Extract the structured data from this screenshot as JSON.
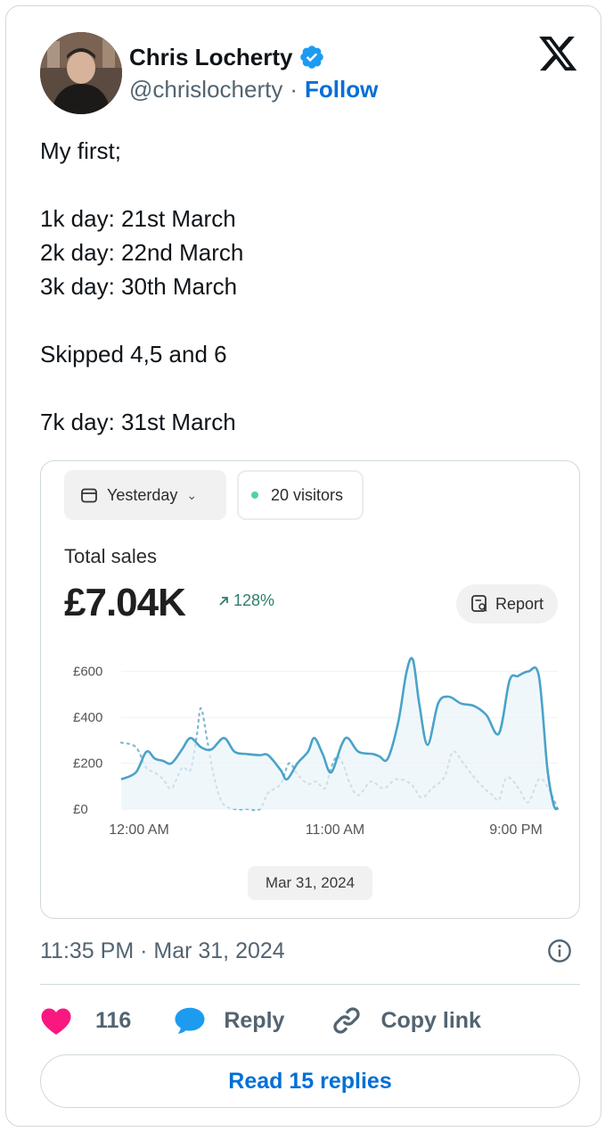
{
  "author": {
    "name": "Chris Locherty",
    "handle": "@chrislocherty",
    "separator": "·",
    "follow_label": "Follow",
    "verified": true,
    "verified_color": "#1d9bf0"
  },
  "tweet": {
    "lines": [
      "My first;",
      "",
      "1k day: 21st March",
      "2k day: 22nd March",
      "3k day: 30th March",
      "",
      "Skipped 4,5 and 6",
      "",
      "7k day: 31st March"
    ]
  },
  "media": {
    "date_filter": "Yesterday",
    "visitors_label": "20 visitors",
    "total_label": "Total sales",
    "total_value": "£7.04K",
    "change_label": "128%",
    "report_label": "Report",
    "date_chip": "Mar 31, 2024"
  },
  "chart_data": {
    "type": "line",
    "ylim": [
      0,
      700
    ],
    "yticks": [
      "£600",
      "£400",
      "£200",
      "£0"
    ],
    "ytick_values": [
      600,
      400,
      200,
      0
    ],
    "xticks": [
      "12:00 AM",
      "11:00 AM",
      "9:00 PM"
    ],
    "xtick_hours": [
      0,
      11,
      21
    ],
    "x_hours_max": 24,
    "series": [
      {
        "style": "solid",
        "color": "#4aa3c9",
        "points": [
          [
            0,
            130
          ],
          [
            0.7,
            160
          ],
          [
            1.2,
            250
          ],
          [
            1.6,
            220
          ],
          [
            2,
            210
          ],
          [
            2.4,
            200
          ],
          [
            2.9,
            260
          ],
          [
            3.3,
            310
          ],
          [
            3.8,
            270
          ],
          [
            4.3,
            260
          ],
          [
            4.9,
            310
          ],
          [
            5.4,
            250
          ],
          [
            6,
            240
          ],
          [
            6.6,
            235
          ],
          [
            7,
            235
          ],
          [
            7.6,
            170
          ],
          [
            7.9,
            130
          ],
          [
            8.4,
            200
          ],
          [
            8.9,
            250
          ],
          [
            9.2,
            310
          ],
          [
            9.6,
            240
          ],
          [
            10,
            160
          ],
          [
            10.5,
            280
          ],
          [
            10.8,
            310
          ],
          [
            11.3,
            250
          ],
          [
            12,
            240
          ],
          [
            12.3,
            230
          ],
          [
            12.7,
            220
          ],
          [
            13.2,
            380
          ],
          [
            13.6,
            600
          ],
          [
            13.9,
            650
          ],
          [
            14.2,
            460
          ],
          [
            14.6,
            280
          ],
          [
            15.1,
            460
          ],
          [
            15.6,
            490
          ],
          [
            16.2,
            460
          ],
          [
            16.8,
            450
          ],
          [
            17.4,
            410
          ],
          [
            18,
            330
          ],
          [
            18.5,
            560
          ],
          [
            18.9,
            580
          ],
          [
            19.4,
            600
          ],
          [
            19.9,
            580
          ],
          [
            20.3,
            180
          ],
          [
            20.6,
            20
          ],
          [
            20.8,
            0
          ]
        ]
      },
      {
        "style": "dotted",
        "color": "#7fb8cf",
        "points": [
          [
            0,
            290
          ],
          [
            0.7,
            270
          ],
          [
            1.2,
            180
          ],
          [
            1.6,
            160
          ],
          [
            2,
            130
          ],
          [
            2.4,
            90
          ],
          [
            2.9,
            180
          ],
          [
            3.3,
            170
          ],
          [
            3.6,
            320
          ],
          [
            3.8,
            440
          ],
          [
            4.1,
            300
          ],
          [
            4.4,
            150
          ],
          [
            4.8,
            30
          ],
          [
            5.4,
            0
          ],
          [
            6,
            0
          ],
          [
            6.6,
            0
          ],
          [
            7,
            70
          ],
          [
            7.6,
            110
          ],
          [
            8,
            200
          ],
          [
            8.4,
            150
          ],
          [
            8.9,
            110
          ],
          [
            9.3,
            120
          ],
          [
            9.7,
            90
          ],
          [
            10,
            180
          ],
          [
            10.3,
            230
          ],
          [
            10.6,
            190
          ],
          [
            10.9,
            110
          ],
          [
            11.3,
            60
          ],
          [
            11.9,
            120
          ],
          [
            12.5,
            90
          ],
          [
            13.1,
            130
          ],
          [
            13.8,
            110
          ],
          [
            14.3,
            50
          ],
          [
            14.8,
            90
          ],
          [
            15.4,
            140
          ],
          [
            15.8,
            250
          ],
          [
            16.3,
            200
          ],
          [
            16.8,
            140
          ],
          [
            17.3,
            90
          ],
          [
            17.7,
            60
          ],
          [
            18,
            40
          ],
          [
            18.3,
            130
          ],
          [
            18.6,
            130
          ],
          [
            19,
            80
          ],
          [
            19.4,
            30
          ],
          [
            19.9,
            130
          ],
          [
            20.3,
            100
          ],
          [
            20.8,
            0
          ]
        ]
      }
    ]
  },
  "footer": {
    "timestamp": "11:35 PM · Mar 31, 2024",
    "likes": "116",
    "reply_label": "Reply",
    "copy_label": "Copy link",
    "read_replies_label": "Read 15 replies",
    "heart_color": "#f91880",
    "reply_bubble_color": "#1d9bf0"
  }
}
